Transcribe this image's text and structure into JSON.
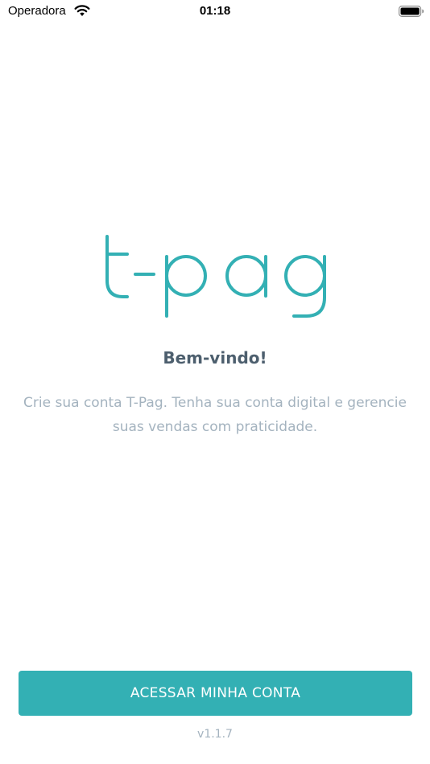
{
  "status_bar": {
    "carrier": "Operadora",
    "time": "01:18",
    "wifi_icon": "wifi-icon",
    "battery_icon": "battery-icon"
  },
  "logo": {
    "text": "t-pag",
    "color": "#33b0b4"
  },
  "welcome": {
    "title": "Bem-vindo!",
    "subtitle": "Crie sua conta T-Pag. Tenha sua conta digital e gerencie suas vendas com praticidade."
  },
  "actions": {
    "access_label": "ACESSAR MINHA CONTA"
  },
  "footer": {
    "version": "v1.1.7"
  },
  "colors": {
    "accent": "#33b0b4",
    "title": "#4d5f6e",
    "muted": "#a4b3bf"
  }
}
